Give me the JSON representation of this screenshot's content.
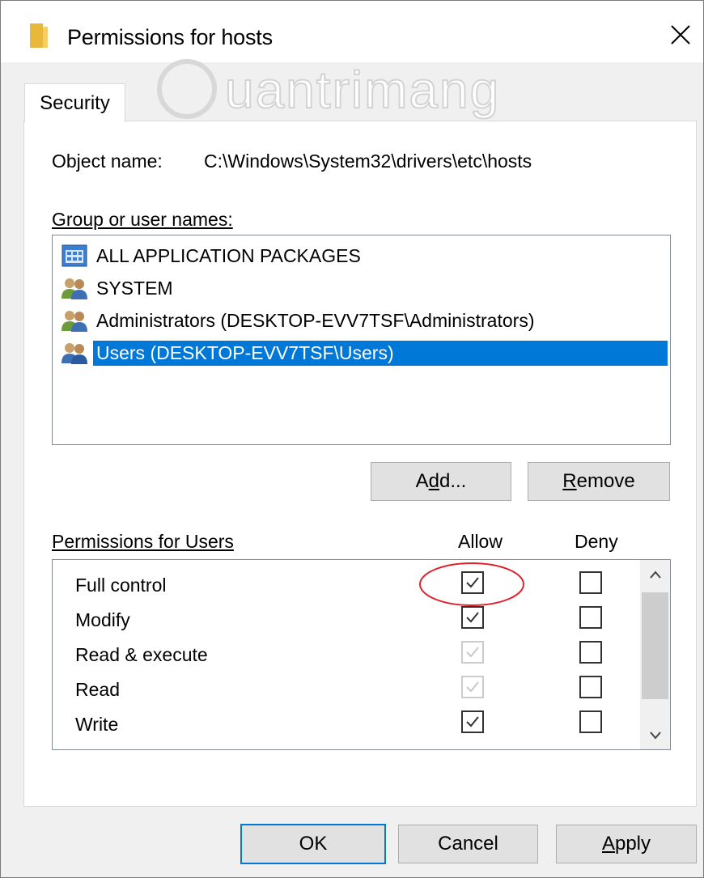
{
  "window": {
    "title": "Permissions for hosts",
    "watermark": "Quantrimang"
  },
  "tab": {
    "label": "Security"
  },
  "object": {
    "label": "Object name:",
    "value": "C:\\Windows\\System32\\drivers\\etc\\hosts"
  },
  "groups": {
    "label": "Group or user names:",
    "items": [
      {
        "label": "ALL APPLICATION PACKAGES",
        "icon": "app-packages-icon",
        "selected": false
      },
      {
        "label": "SYSTEM",
        "icon": "users-icon",
        "selected": false
      },
      {
        "label": "Administrators (DESKTOP-EVV7TSF\\Administrators)",
        "icon": "users-icon",
        "selected": false
      },
      {
        "label": "Users (DESKTOP-EVV7TSF\\Users)",
        "icon": "users-icon",
        "selected": true
      }
    ],
    "add_button": {
      "label_pre": "A",
      "label_key": "d",
      "label_post": "d..."
    },
    "remove_button": {
      "label_key": "R",
      "label_post": "emove"
    }
  },
  "permissions": {
    "label": "Permissions for Users",
    "allow_header": "Allow",
    "deny_header": "Deny",
    "rows": [
      {
        "name": "Full control",
        "allow": "checked",
        "deny": "unchecked"
      },
      {
        "name": "Modify",
        "allow": "checked",
        "deny": "unchecked"
      },
      {
        "name": "Read & execute",
        "allow": "checked-disabled",
        "deny": "unchecked"
      },
      {
        "name": "Read",
        "allow": "checked-disabled",
        "deny": "unchecked"
      },
      {
        "name": "Write",
        "allow": "checked",
        "deny": "unchecked"
      }
    ]
  },
  "footer": {
    "ok_label": "OK",
    "cancel_label": "Cancel",
    "apply_label_key": "A",
    "apply_label_post": "pply"
  },
  "colors": {
    "selection": "#0078d7",
    "annotation_circle": "#e0202a",
    "folder": "#e8b83a"
  }
}
